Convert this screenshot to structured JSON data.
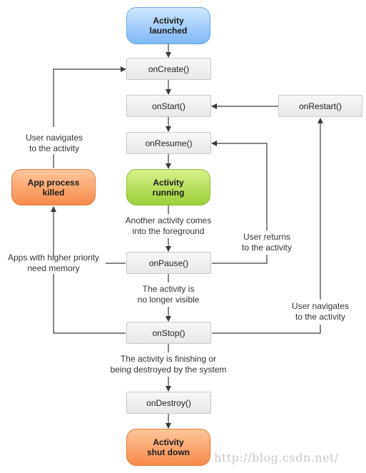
{
  "nodes": {
    "launched": "Activity\nlaunched",
    "onCreate": "onCreate()",
    "onStart": "onStart()",
    "onRestart": "onRestart()",
    "onResume": "onResume()",
    "running": "Activity\nrunning",
    "killed": "App process\nkilled",
    "onPause": "onPause()",
    "onStop": "onStop()",
    "onDestroy": "onDestroy()",
    "shutdown": "Activity\nshut down"
  },
  "labels": {
    "user_navigates_left": "User navigates\nto the activity",
    "another_activity": "Another activity comes\ninto the foreground",
    "user_returns": "User returns\nto the activity",
    "higher_priority": "Apps with higher priority\nneed memory",
    "no_longer_visible": "The activity is\nno longer visible",
    "user_navigates_right": "User navigates\nto the activity",
    "finishing": "The activity is finishing or\nbeing destroyed by the system"
  },
  "colors": {
    "launched": "#7db8f7",
    "running": "#9ccf3a",
    "killed": "#f58a4a",
    "shutdown": "#f58a4a",
    "arrow": "#3a3a3a"
  },
  "watermark": "http://blog.csdn.net/"
}
